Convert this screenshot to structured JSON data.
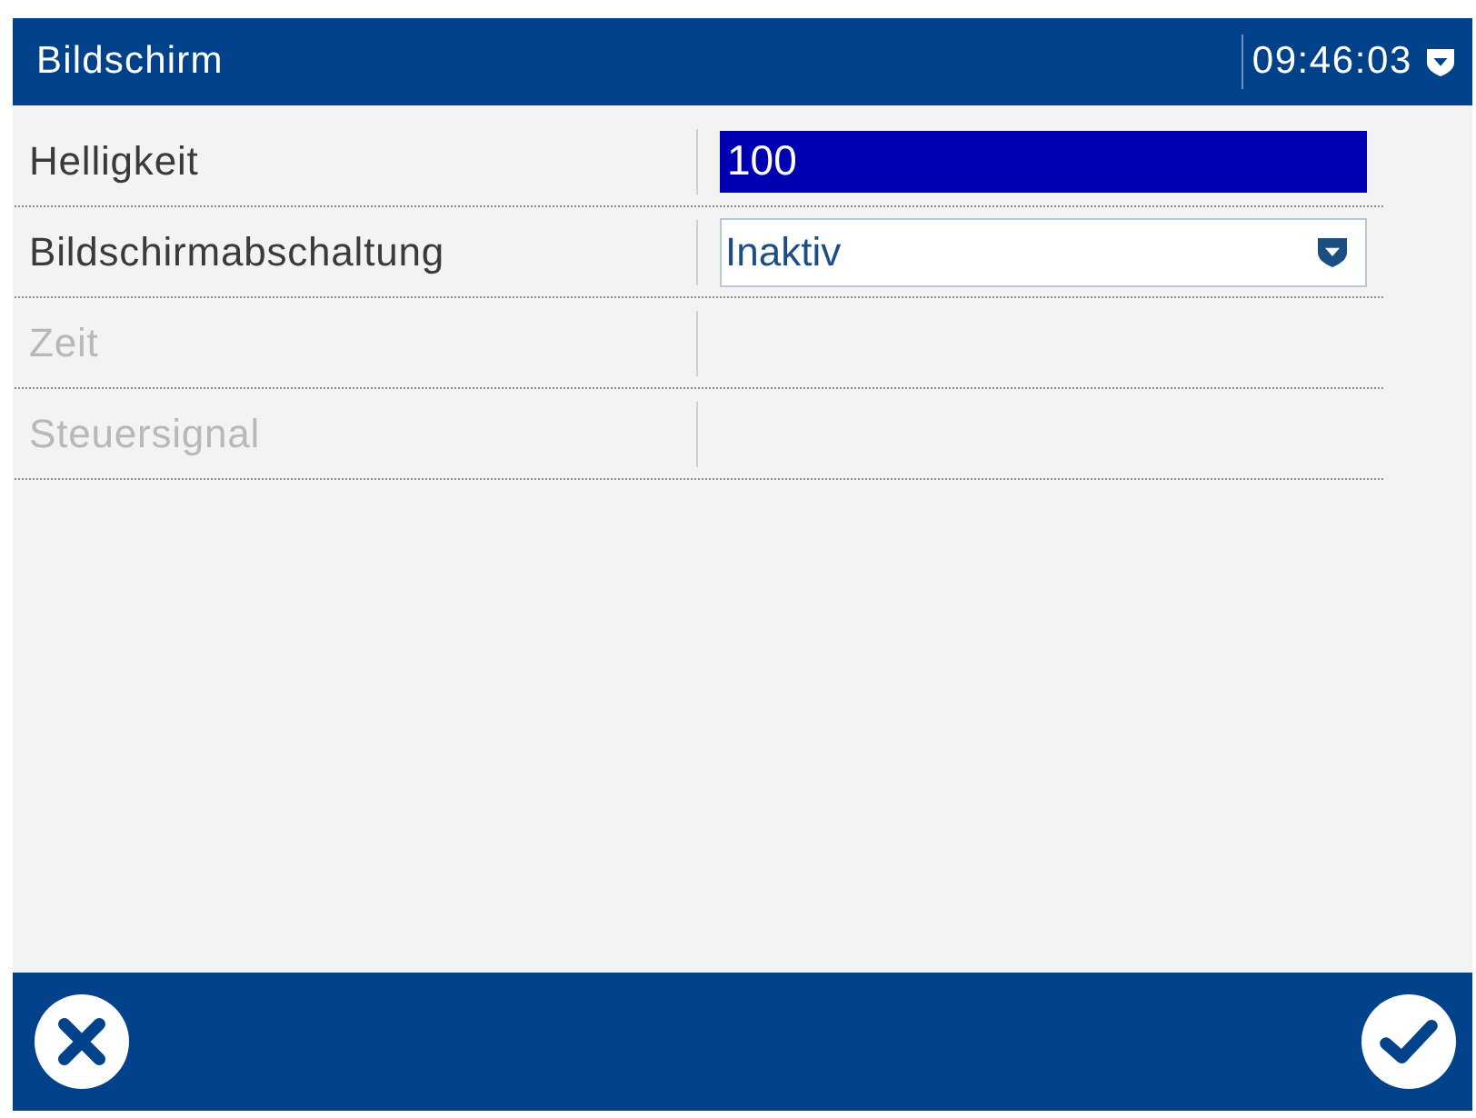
{
  "window": {
    "title": "Bildschirm",
    "clock": "09:46:03"
  },
  "settings": [
    {
      "label": "Helligkeit",
      "kind": "number",
      "value": "100",
      "selected": true,
      "disabled": false
    },
    {
      "label": "Bildschirmabschaltung",
      "kind": "dropdown",
      "value": "Inaktiv",
      "selected": false,
      "disabled": false
    },
    {
      "label": "Zeit",
      "kind": "empty",
      "selected": false,
      "disabled": true
    },
    {
      "label": "Steuersignal",
      "kind": "empty",
      "selected": false,
      "disabled": true
    }
  ],
  "footer": {
    "buttons": [
      {
        "kind": "cancel"
      },
      {
        "kind": "confirm"
      }
    ]
  }
}
